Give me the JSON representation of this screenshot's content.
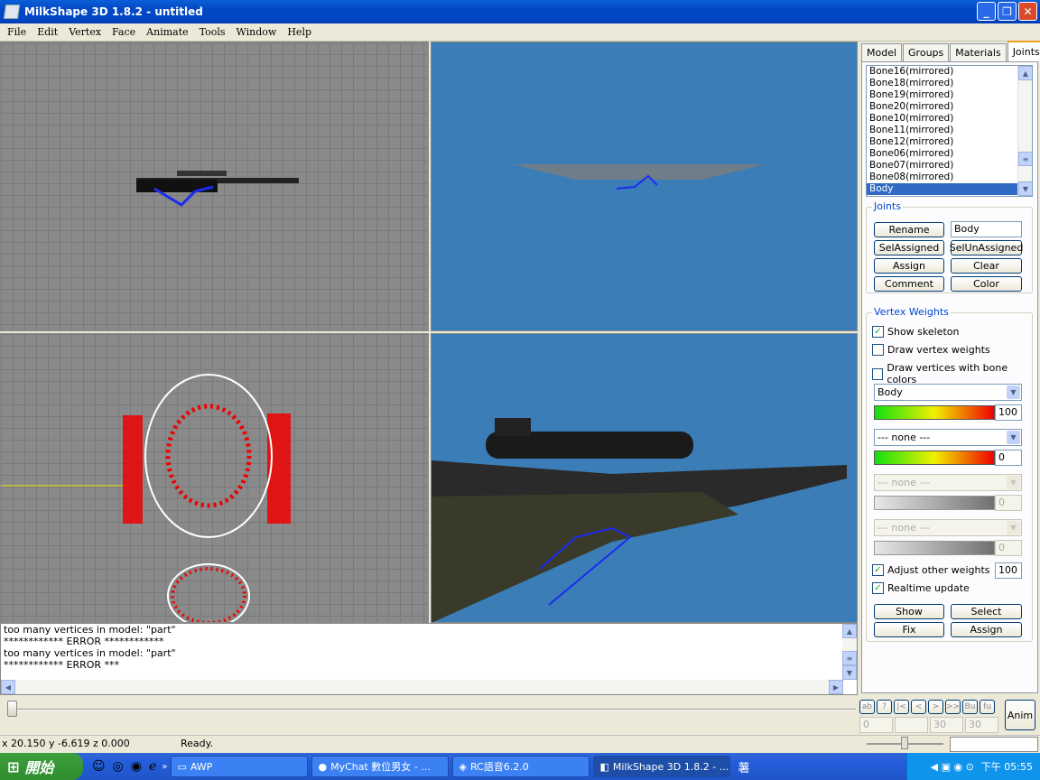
{
  "window": {
    "title": "MilkShape 3D 1.8.2 - untitled"
  },
  "menu": [
    "File",
    "Edit",
    "Vertex",
    "Face",
    "Animate",
    "Tools",
    "Window",
    "Help"
  ],
  "tabs": [
    "Model",
    "Groups",
    "Materials",
    "Joints"
  ],
  "active_tab": "Joints",
  "joints_list": [
    "Bone16(mirrored)",
    "Bone18(mirrored)",
    "Bone19(mirrored)",
    "Bone20(mirrored)",
    "Bone10(mirrored)",
    "Bone11(mirrored)",
    "Bone12(mirrored)",
    "Bone06(mirrored)",
    "Bone07(mirrored)",
    "Bone08(mirrored)",
    "Body"
  ],
  "selected_joint": "Body",
  "joints_group": {
    "label": "Joints",
    "rename": "Rename",
    "name_value": "Body",
    "sel_assigned": "SelAssigned",
    "sel_unassigned": "SelUnAssigned",
    "assign": "Assign",
    "clear": "Clear",
    "comment": "Comment",
    "color": "Color"
  },
  "vertex_weights": {
    "label": "Vertex Weights",
    "show_skeleton": "Show skeleton",
    "draw_vertex_weights": "Draw vertex weights",
    "draw_vertices_bone_colors": "Draw vertices with bone colors",
    "bone1": "Body",
    "weight1": "100",
    "bone2": "--- none ---",
    "weight2": "0",
    "bone3": "--- none ---",
    "weight3": "0",
    "bone4": "--- none ---",
    "weight4": "0",
    "adjust_other": "Adjust other weights",
    "adjust_value": "100",
    "realtime": "Realtime update",
    "show": "Show",
    "select": "Select",
    "fix": "Fix",
    "assign": "Assign"
  },
  "log": [
    "too many vertices in model: \"part\"",
    "************ ERROR ************",
    "too many vertices in model: \"part\"",
    "************ ERROR ***"
  ],
  "anim": {
    "btn": "Anim",
    "frame_start": "0",
    "frame_cur": "30",
    "frame_end": "30",
    "ctrls": [
      "ab",
      "?",
      "|<",
      "<",
      ">",
      ">>",
      "Bu",
      "fu"
    ]
  },
  "status": {
    "coords": "x 20.150 y -6.619 z 0.000",
    "msg": "Ready."
  },
  "taskbar": {
    "start": "開始",
    "items": [
      "AWP",
      "MyChat 數位男女 - ...",
      "RC語音6.2.0",
      "MilkShape 3D 1.8.2 - ..."
    ],
    "clock": "下午 05:55",
    "ime": "薯"
  }
}
